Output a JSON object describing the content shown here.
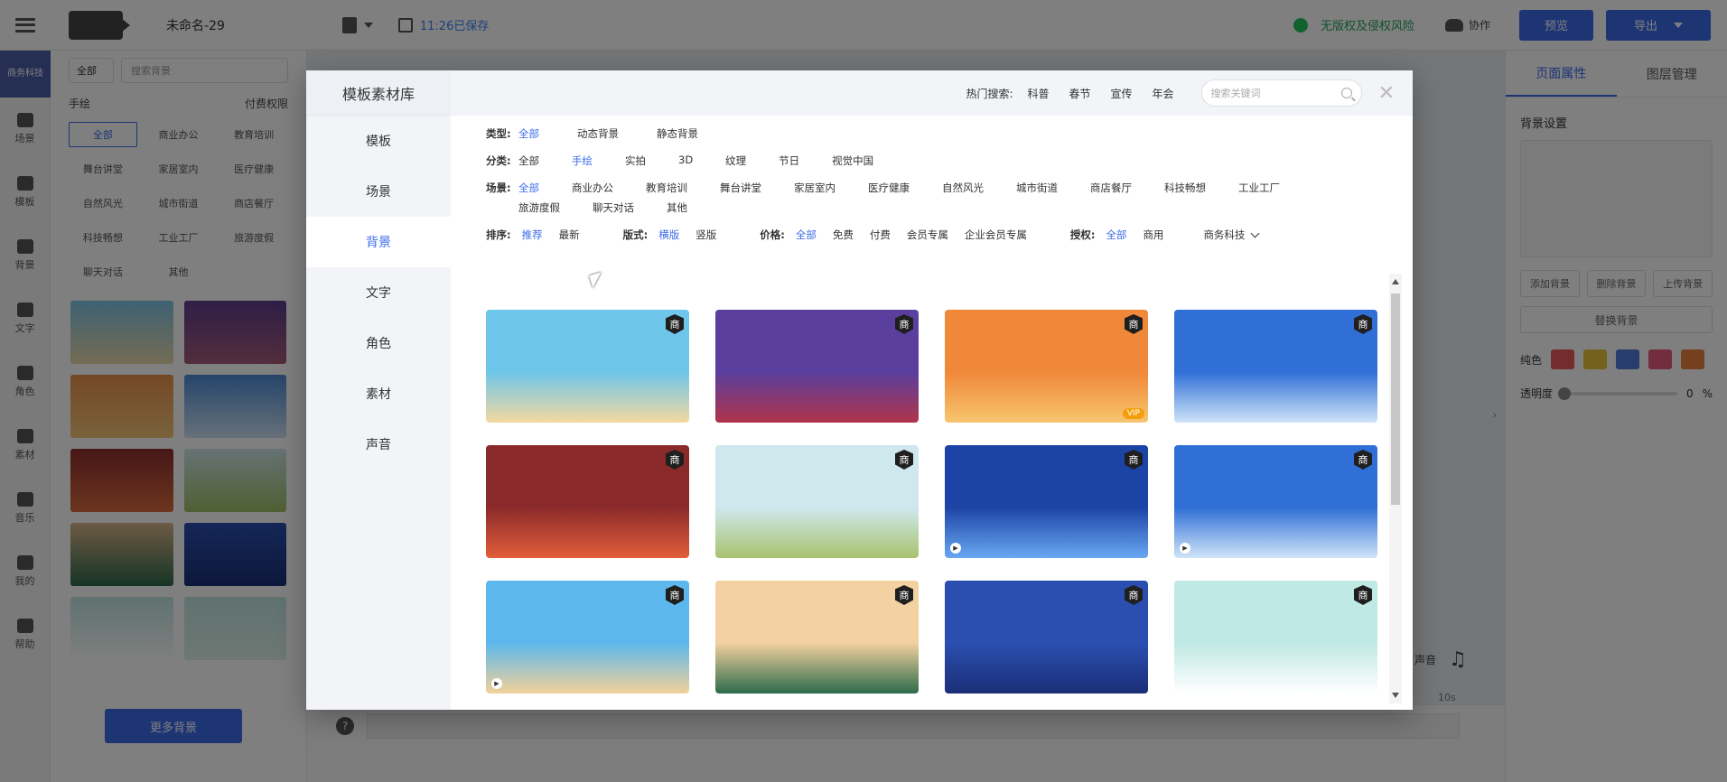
{
  "app": {
    "doc_title": "未命名-29",
    "saved_text": "11:26已保存",
    "risk_text": "无版权及侵权风险",
    "collab_label": "协作",
    "preview_label": "预览",
    "export_label": "导出",
    "brand_text": "商务科技"
  },
  "leftnav": [
    {
      "label": "场景",
      "icon": "scene-icon"
    },
    {
      "label": "模板",
      "icon": "template-icon"
    },
    {
      "label": "背景",
      "icon": "background-icon"
    },
    {
      "label": "文字",
      "icon": "text-icon"
    },
    {
      "label": "角色",
      "icon": "character-icon"
    },
    {
      "label": "素材",
      "icon": "material-icon"
    },
    {
      "label": "音乐",
      "icon": "music-icon"
    },
    {
      "label": "我的",
      "icon": "mine-icon"
    },
    {
      "label": "帮助",
      "icon": "help-icon"
    }
  ],
  "leftpanel": {
    "select_value": "全部",
    "search_placeholder": "搜索背景",
    "back_label": "手绘",
    "perm_label": "付费权限",
    "tags": [
      "全部",
      "商业办公",
      "教育培训",
      "舞台讲堂",
      "家居室内",
      "医疗健康",
      "自然风光",
      "城市街道",
      "商店餐厅",
      "科技畅想",
      "工业工厂",
      "旅游度假",
      "聊天对话",
      "其他"
    ],
    "more_label": "更多背景"
  },
  "timeline": {
    "time_label": "10s",
    "sound_label": "声音"
  },
  "rightpanel": {
    "tabs": [
      "页面属性",
      "图层管理"
    ],
    "section_title": "背景设置",
    "buttons": [
      "添加背景",
      "删除背景",
      "上传背景"
    ],
    "replace_label": "替换背景",
    "color_label": "纯色",
    "swatch_colors": [
      "#e85b5b",
      "#e8c23b",
      "#4f7ad6",
      "#e85b7a",
      "#e8803b"
    ],
    "opacity_label": "透明度",
    "opacity_value": "0",
    "opacity_unit": "%"
  },
  "modal": {
    "title": "模板素材库",
    "side_items": [
      "模板",
      "场景",
      "背景",
      "文字",
      "角色",
      "素材",
      "声音"
    ],
    "active_side": "背景",
    "hot_label": "热门搜索:",
    "hot_keywords": [
      "科普",
      "春节",
      "宣传",
      "年会"
    ],
    "search_placeholder": "搜索关键词",
    "filters": {
      "type": {
        "label": "类型:",
        "options": [
          "全部",
          "动态背景",
          "静态背景"
        ],
        "active": "全部"
      },
      "category": {
        "label": "分类:",
        "options": [
          "全部",
          "手绘",
          "实拍",
          "3D",
          "纹理",
          "节日",
          "视觉中国"
        ],
        "active": "手绘"
      },
      "scene": {
        "label": "场景:",
        "options": [
          "全部",
          "商业办公",
          "教育培训",
          "舞台讲堂",
          "家居室内",
          "医疗健康",
          "自然风光",
          "城市街道",
          "商店餐厅",
          "科技畅想",
          "工业工厂",
          "旅游度假",
          "聊天对话",
          "其他"
        ],
        "active": "全部"
      },
      "sort": {
        "label": "排序:",
        "options": [
          "推荐",
          "最新"
        ],
        "active": "推荐"
      },
      "layout": {
        "label": "版式:",
        "options": [
          "横版",
          "竖版"
        ],
        "active": "横版"
      },
      "price": {
        "label": "价格:",
        "options": [
          "全部",
          "免费",
          "付费",
          "会员专属",
          "企业会员专属"
        ],
        "active": "全部"
      },
      "license": {
        "label": "授权:",
        "options": [
          "全部",
          "商用"
        ],
        "active": "全部"
      },
      "business_dropdown": "商务科技"
    },
    "thumbs": [
      {
        "name": "beach-palm",
        "badge": "商",
        "vip": false,
        "play": false,
        "colors": [
          "#6ec6ea",
          "#f3d9a0"
        ]
      },
      {
        "name": "purple-stage",
        "badge": "商",
        "vip": false,
        "play": false,
        "colors": [
          "#5a3f9e",
          "#b0344a"
        ]
      },
      {
        "name": "sunset-beach",
        "badge": "商",
        "vip": true,
        "play": false,
        "colors": [
          "#f0883a",
          "#f7c56e"
        ]
      },
      {
        "name": "news-studio",
        "badge": "商",
        "vip": false,
        "play": false,
        "colors": [
          "#2f6fd6",
          "#cfe4f8"
        ]
      },
      {
        "name": "red-curtain-stage",
        "badge": "商",
        "vip": false,
        "play": false,
        "colors": [
          "#8b2a2a",
          "#e35d3a"
        ]
      },
      {
        "name": "bus-stop",
        "badge": "商",
        "vip": false,
        "play": false,
        "colors": [
          "#cfe8ee",
          "#a8c36e"
        ]
      },
      {
        "name": "tech-screen",
        "badge": "商",
        "vip": false,
        "play": true,
        "colors": [
          "#1c44a6",
          "#6aa7f2"
        ]
      },
      {
        "name": "news-studio-2",
        "badge": "商",
        "vip": false,
        "play": true,
        "colors": [
          "#2f6fd6",
          "#cfe4f8"
        ]
      },
      {
        "name": "blue-sea",
        "badge": "商",
        "vip": false,
        "play": true,
        "colors": [
          "#5cb8ec",
          "#f3d19a"
        ]
      },
      {
        "name": "classroom",
        "badge": "商",
        "vip": false,
        "play": false,
        "colors": [
          "#f3d1a0",
          "#2d6b4a"
        ]
      },
      {
        "name": "night-city",
        "badge": "商",
        "vip": false,
        "play": false,
        "colors": [
          "#2a4fb0",
          "#1b2f78"
        ]
      },
      {
        "name": "leafy-light",
        "badge": "商",
        "vip": false,
        "play": false,
        "colors": [
          "#bfe9e4",
          "#ffffff"
        ]
      }
    ]
  },
  "left_thumb_colors": [
    [
      "#7cc4e6",
      "#e8d8a8"
    ],
    [
      "#5e3e8e",
      "#a65b7a"
    ],
    [
      "#e98f4a",
      "#f3c77a"
    ],
    [
      "#4d8ad6",
      "#cfe2f4"
    ],
    [
      "#8e2e2e",
      "#d86b3d"
    ],
    [
      "#cfe6e8",
      "#9fbf67"
    ],
    [
      "#d9b58a",
      "#2d6a4a"
    ],
    [
      "#2a4fb0",
      "#1b2f78"
    ],
    [
      "#bfe5e0",
      "#ffffff"
    ],
    [
      "#bfe5e0",
      "#dcefe8"
    ]
  ]
}
